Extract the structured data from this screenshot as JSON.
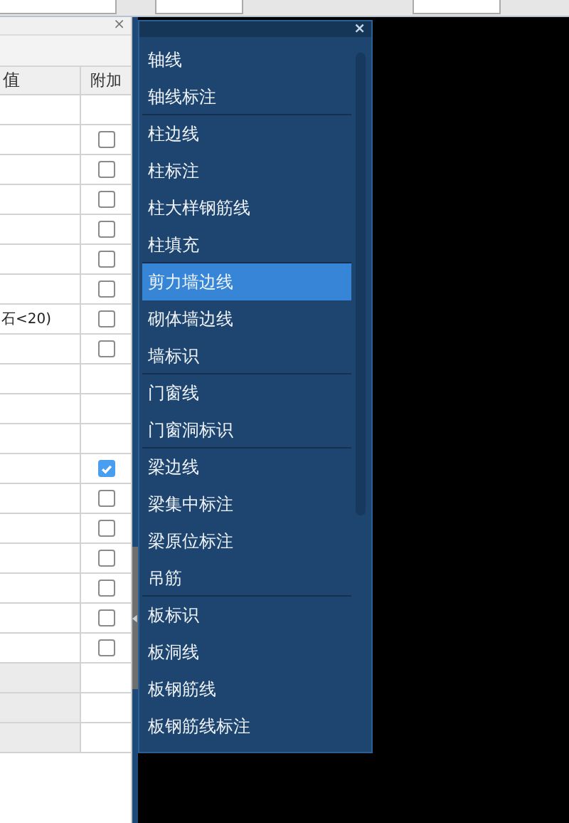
{
  "properties_panel": {
    "close": "×",
    "columns": [
      "值",
      "附加"
    ],
    "rows": [
      {
        "kind": "blank",
        "value": ""
      },
      {
        "kind": "checkbox",
        "value": "",
        "checked": false
      },
      {
        "kind": "checkbox",
        "value": "",
        "checked": false
      },
      {
        "kind": "checkbox",
        "value": "",
        "checked": false
      },
      {
        "kind": "checkbox",
        "value": "",
        "checked": false
      },
      {
        "kind": "checkbox",
        "value": "",
        "checked": false
      },
      {
        "kind": "checkbox",
        "value": "",
        "checked": false
      },
      {
        "kind": "checkbox",
        "value": "石<20)",
        "checked": false
      },
      {
        "kind": "checkbox",
        "value": "",
        "checked": false
      },
      {
        "kind": "blank",
        "value": ""
      },
      {
        "kind": "blank",
        "value": ""
      },
      {
        "kind": "blank",
        "value": ""
      },
      {
        "kind": "checkbox",
        "value": "",
        "checked": true
      },
      {
        "kind": "checkbox",
        "value": "",
        "checked": false
      },
      {
        "kind": "checkbox",
        "value": "",
        "checked": false
      },
      {
        "kind": "checkbox",
        "value": "",
        "checked": false
      },
      {
        "kind": "checkbox",
        "value": "",
        "checked": false
      },
      {
        "kind": "checkbox",
        "value": "",
        "checked": false
      },
      {
        "kind": "checkbox",
        "value": "",
        "checked": false
      },
      {
        "kind": "group",
        "value": ""
      },
      {
        "kind": "group",
        "value": ""
      },
      {
        "kind": "group",
        "value": ""
      }
    ]
  },
  "layer_menu": {
    "close": "×",
    "items": [
      {
        "label": "轴线",
        "selected": false,
        "separator_after": false
      },
      {
        "label": "轴线标注",
        "selected": false,
        "separator_after": true
      },
      {
        "label": "柱边线",
        "selected": false,
        "separator_after": false
      },
      {
        "label": "柱标注",
        "selected": false,
        "separator_after": false
      },
      {
        "label": "柱大样钢筋线",
        "selected": false,
        "separator_after": false
      },
      {
        "label": "柱填充",
        "selected": false,
        "separator_after": true
      },
      {
        "label": "剪力墙边线",
        "selected": true,
        "separator_after": false
      },
      {
        "label": "砌体墙边线",
        "selected": false,
        "separator_after": false
      },
      {
        "label": "墙标识",
        "selected": false,
        "separator_after": true
      },
      {
        "label": "门窗线",
        "selected": false,
        "separator_after": false
      },
      {
        "label": "门窗洞标识",
        "selected": false,
        "separator_after": true
      },
      {
        "label": "梁边线",
        "selected": false,
        "separator_after": false
      },
      {
        "label": "梁集中标注",
        "selected": false,
        "separator_after": false
      },
      {
        "label": "梁原位标注",
        "selected": false,
        "separator_after": false
      },
      {
        "label": "吊筋",
        "selected": false,
        "separator_after": true
      },
      {
        "label": "板标识",
        "selected": false,
        "separator_after": false
      },
      {
        "label": "板洞线",
        "selected": false,
        "separator_after": false
      },
      {
        "label": "板钢筋线",
        "selected": false,
        "separator_after": false
      },
      {
        "label": "板钢筋线标注",
        "selected": false,
        "separator_after": false
      }
    ]
  }
}
